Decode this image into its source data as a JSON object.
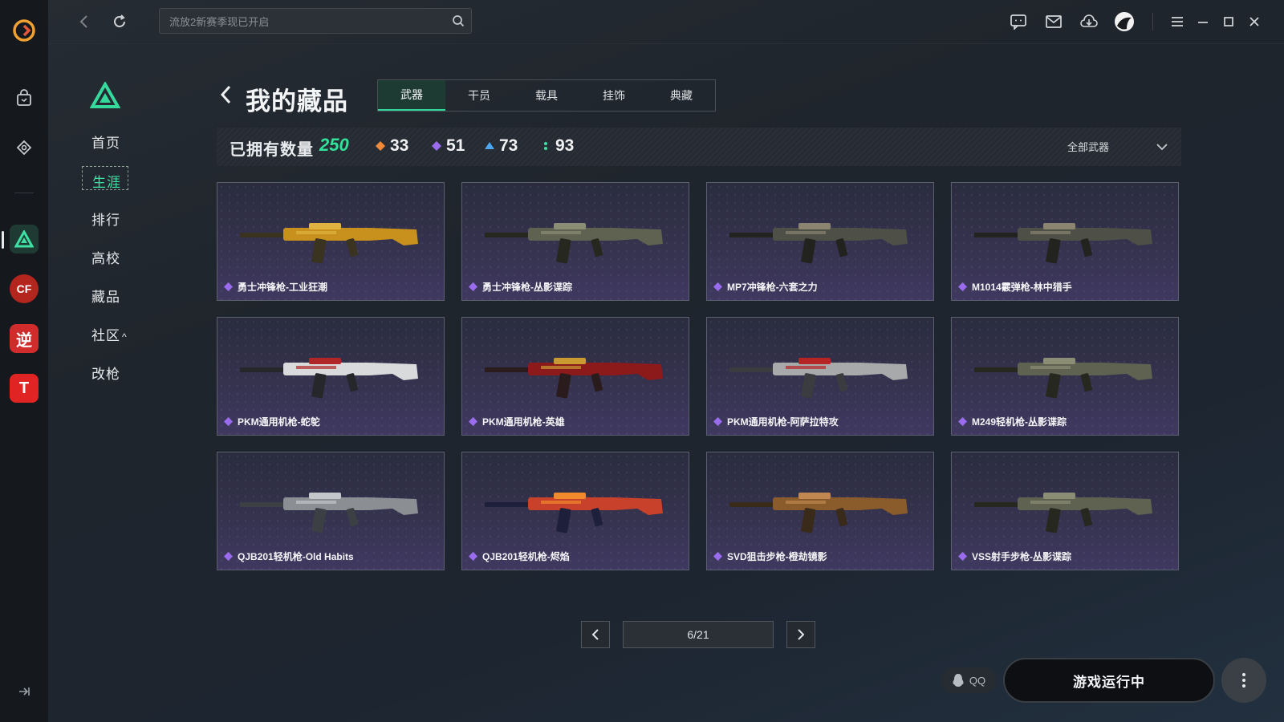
{
  "search": {
    "placeholder": "流放2新赛季现已开启"
  },
  "sidebar_nav": {
    "items": [
      {
        "label": "首页",
        "active": false
      },
      {
        "label": "生涯",
        "active": true
      },
      {
        "label": "排行",
        "active": false
      },
      {
        "label": "高校",
        "active": false
      },
      {
        "label": "藏品",
        "active": false
      },
      {
        "label": "社区",
        "active": false,
        "caret": "^"
      },
      {
        "label": "改枪",
        "active": false
      }
    ]
  },
  "rail": {
    "games": [
      "CF",
      "逆",
      "T"
    ]
  },
  "header": {
    "title": "我的藏品",
    "tabs": [
      {
        "label": "武器",
        "active": true
      },
      {
        "label": "干员",
        "active": false
      },
      {
        "label": "载具",
        "active": false
      },
      {
        "label": "挂饰",
        "active": false
      },
      {
        "label": "典藏",
        "active": false
      }
    ]
  },
  "stats": {
    "owned_label": "已拥有数量",
    "owned_count": "250",
    "rarities": [
      {
        "count": "33",
        "color": "#f08a3a"
      },
      {
        "count": "51",
        "color": "#9b6cf0"
      },
      {
        "count": "73",
        "color": "#4fa6f0"
      },
      {
        "count": "93",
        "color": "#3fe0a3"
      }
    ],
    "filter_label": "全部武器"
  },
  "items": [
    {
      "name": "勇士冲锋枪-工业狂潮",
      "style": "gold"
    },
    {
      "name": "勇士冲锋枪-丛影谍踪",
      "style": "camo"
    },
    {
      "name": "MP7冲锋枪-六套之力",
      "style": "camo-dark"
    },
    {
      "name": "M1014霰弹枪-林中猎手",
      "style": "camo-dark"
    },
    {
      "name": "PKM通用机枪-蛇鸵",
      "style": "white-red"
    },
    {
      "name": "PKM通用机枪-英雄",
      "style": "red"
    },
    {
      "name": "PKM通用机枪-阿萨拉特攻",
      "style": "silver-red"
    },
    {
      "name": "M249轻机枪-丛影谍踪",
      "style": "camo"
    },
    {
      "name": "QJB201轻机枪-Old Habits",
      "style": "grey"
    },
    {
      "name": "QJB201轻机枪-烬焰",
      "style": "flame"
    },
    {
      "name": "SVD狙击步枪-橙劫镜影",
      "style": "bronze"
    },
    {
      "name": "VSS射手步枪-丛影谍踪",
      "style": "camo"
    }
  ],
  "item_gem_color": "#9b6cf0",
  "pagination": {
    "label": "6/21"
  },
  "bottom": {
    "qq_label": "QQ",
    "run_label": "游戏运行中"
  },
  "accent": "#33d69a"
}
